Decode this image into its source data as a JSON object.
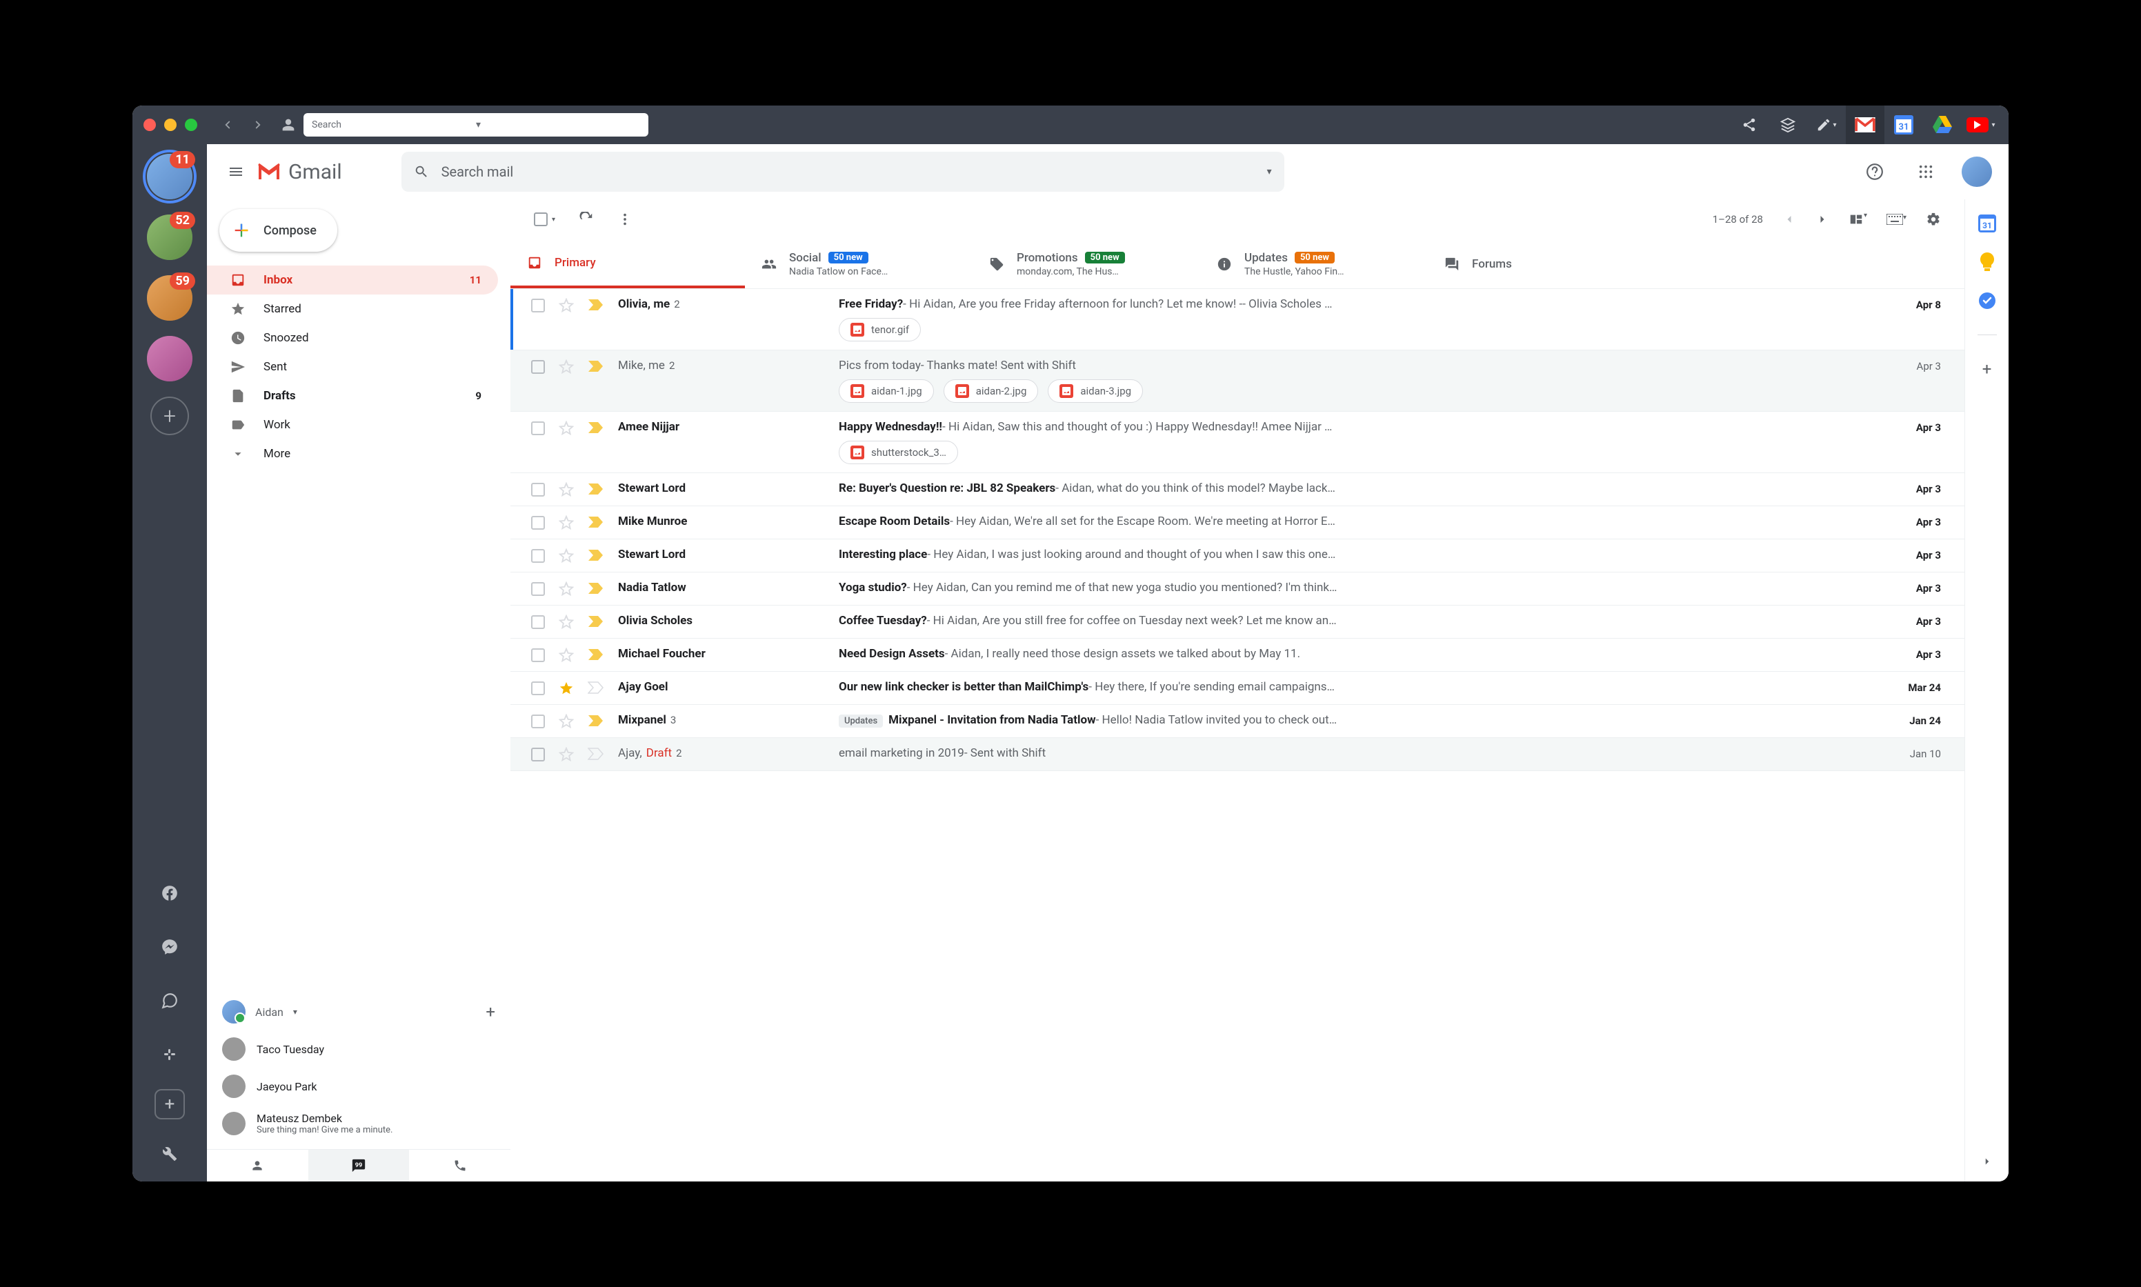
{
  "titlebar": {
    "search_placeholder": "Search"
  },
  "header": {
    "brand": "Gmail",
    "search_placeholder": "Search mail"
  },
  "compose_label": "Compose",
  "nav": {
    "inbox": {
      "label": "Inbox",
      "count": "11"
    },
    "starred": {
      "label": "Starred"
    },
    "snoozed": {
      "label": "Snoozed"
    },
    "sent": {
      "label": "Sent"
    },
    "drafts": {
      "label": "Drafts",
      "count": "9"
    },
    "work": {
      "label": "Work"
    },
    "more": {
      "label": "More"
    }
  },
  "hangouts": {
    "me": "Aidan",
    "contacts": [
      {
        "name": "Taco Tuesday",
        "sub": ""
      },
      {
        "name": "Jaeyou Park",
        "sub": ""
      },
      {
        "name": "Mateusz Dembek",
        "sub": "Sure thing man! Give me a minute."
      }
    ]
  },
  "toolbar": {
    "range": "1–28 of 28"
  },
  "tabs": {
    "primary": {
      "label": "Primary"
    },
    "social": {
      "label": "Social",
      "pill": "50 new",
      "sub": "Nadia Tatlow on Face…"
    },
    "promotions": {
      "label": "Promotions",
      "pill": "50 new",
      "sub": "monday.com, The Hus…"
    },
    "updates": {
      "label": "Updates",
      "pill": "50 new",
      "sub": "The Hustle, Yahoo Fin…"
    },
    "forums": {
      "label": "Forums"
    }
  },
  "workspaces": [
    {
      "badge": "11"
    },
    {
      "badge": "52"
    },
    {
      "badge": "59"
    },
    {
      "badge": ""
    }
  ],
  "emails": [
    {
      "sender": "Olivia, me",
      "sender_count": "2",
      "subject": "Free Friday?",
      "snippet": " - Hi Aidan, Are you free Friday afternoon for lunch? Let me know! -- Olivia Scholes …",
      "date": "Apr 8",
      "unread": true,
      "important": true,
      "starred": false,
      "selected": true,
      "attachments": [
        "tenor.gif"
      ]
    },
    {
      "sender": "Mike, me",
      "sender_count": "2",
      "subject": "Pics from today",
      "snippet": " - Thanks mate! Sent with Shift",
      "date": "Apr 3",
      "unread": false,
      "important": true,
      "starred": false,
      "attachments": [
        "aidan-1.jpg",
        "aidan-2.jpg",
        "aidan-3.jpg"
      ]
    },
    {
      "sender": "Amee Nijjar",
      "sender_count": "",
      "subject": "Happy Wednesday!!",
      "snippet": " - Hi Aidan, Saw this and thought of you :) Happy Wednesday!! Amee Nijjar …",
      "date": "Apr 3",
      "unread": true,
      "important": true,
      "starred": false,
      "attachments": [
        "shutterstock_3…"
      ]
    },
    {
      "sender": "Stewart Lord",
      "sender_count": "",
      "subject": "Re: Buyer's Question re: JBL 82 Speakers",
      "snippet": " - Aidan, what do you think of this model? Maybe lack…",
      "date": "Apr 3",
      "unread": true,
      "important": true,
      "starred": false
    },
    {
      "sender": "Mike Munroe",
      "sender_count": "",
      "subject": "Escape Room Details",
      "snippet": " - Hey Aidan, We're all set for the Escape Room. We're meeting at Horror E…",
      "date": "Apr 3",
      "unread": true,
      "important": true,
      "starred": false
    },
    {
      "sender": "Stewart Lord",
      "sender_count": "",
      "subject": "Interesting place",
      "snippet": " - Hey Aidan, I was just looking around and thought of you when I saw this one…",
      "date": "Apr 3",
      "unread": true,
      "important": true,
      "starred": false
    },
    {
      "sender": "Nadia Tatlow",
      "sender_count": "",
      "subject": "Yoga studio?",
      "snippet": " - Hey Aidan, Can you remind me of that new yoga studio you mentioned? I'm think…",
      "date": "Apr 3",
      "unread": true,
      "important": true,
      "starred": false
    },
    {
      "sender": "Olivia Scholes",
      "sender_count": "",
      "subject": "Coffee Tuesday?",
      "snippet": " - Hi Aidan, Are you still free for coffee on Tuesday next week? Let me know an…",
      "date": "Apr 3",
      "unread": true,
      "important": true,
      "starred": false
    },
    {
      "sender": "Michael Foucher",
      "sender_count": "",
      "subject": "Need Design Assets",
      "snippet": " - Aidan, I really need those design assets we talked about by May 11.",
      "date": "Apr 3",
      "unread": true,
      "important": true,
      "starred": false
    },
    {
      "sender": "Ajay Goel",
      "sender_count": "",
      "subject": "Our new link checker is better than MailChimp's",
      "snippet": " - Hey there, If you're sending email campaigns…",
      "date": "Mar 24",
      "unread": true,
      "important": false,
      "starred": true
    },
    {
      "sender": "Mixpanel",
      "sender_count": "3",
      "subject": "Mixpanel - Invitation from Nadia Tatlow",
      "snippet": " - Hello! Nadia Tatlow invited you to check out…",
      "date": "Jan 24",
      "unread": true,
      "important": true,
      "starred": false,
      "label": "Updates"
    },
    {
      "sender": "Ajay, ",
      "sender_draft": "Draft",
      "sender_count": "2",
      "subject": "email marketing in 2019",
      "snippet": " - Sent with Shift",
      "date": "Jan 10",
      "unread": false,
      "important": false,
      "starred": false
    }
  ]
}
